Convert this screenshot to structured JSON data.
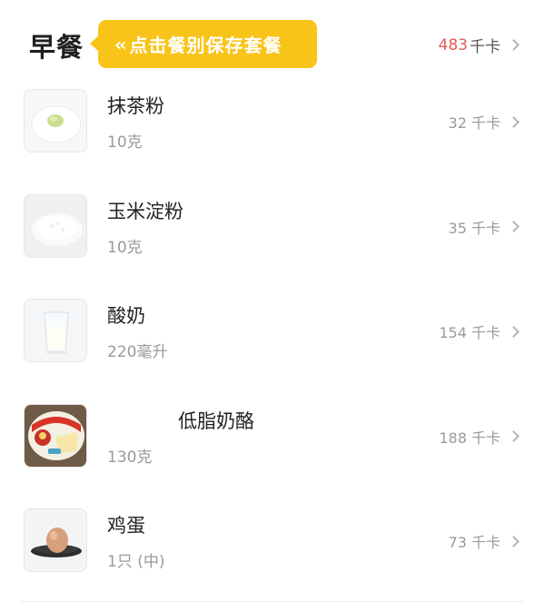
{
  "header": {
    "meal_title": "早餐",
    "tooltip_text": "点击餐别保存套餐",
    "tooltip_icon": "double-chevron-left-icon",
    "total_kcal": "483",
    "total_unit": "千卡"
  },
  "colors": {
    "accent_yellow": "#f9c41a",
    "kcal_red": "#e25b52"
  },
  "items": [
    {
      "name": "抹茶粉",
      "portion": "10克",
      "kcal": "32 千卡",
      "thumb_icon": "matcha-powder-image"
    },
    {
      "name": "玉米淀粉",
      "portion": "10克",
      "kcal": "35 千卡",
      "thumb_icon": "corn-starch-image"
    },
    {
      "name": "酸奶",
      "portion": "220毫升",
      "kcal": "154 千卡",
      "thumb_icon": "yogurt-glass-image"
    },
    {
      "name": "低脂奶酪",
      "portion": "130克",
      "kcal": "188 千卡",
      "thumb_icon": "laughing-cow-cheese-image"
    },
    {
      "name": "鸡蛋",
      "portion": "1只 (中)",
      "kcal": "73 千卡",
      "thumb_icon": "egg-on-plate-image"
    }
  ]
}
